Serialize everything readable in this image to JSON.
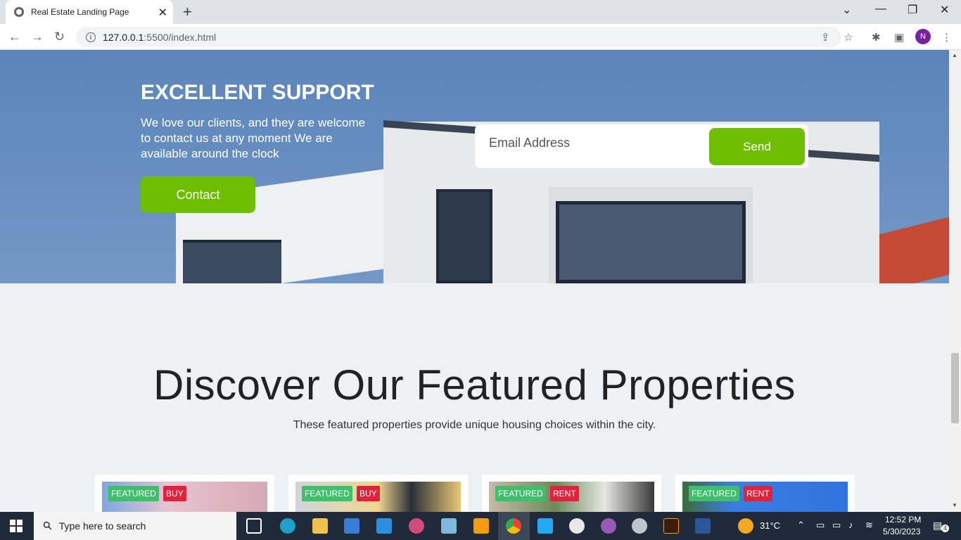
{
  "browser": {
    "tab_title": "Real Estate Landing Page",
    "url_host": "127.0.0.1",
    "url_rest": ":5500/index.html",
    "profile_initial": "N"
  },
  "hero": {
    "title": "EXCELLENT SUPPORT",
    "text": "We love our clients, and they are welcome to contact us at any moment We are available around the clock",
    "contact_label": "Contact",
    "email_placeholder": "Email Address",
    "send_label": "Send"
  },
  "featured": {
    "title": "Discover Our Featured Properties",
    "subtitle": "These featured properties provide unique housing choices within the city.",
    "cards": [
      {
        "badge1": "FEATURED",
        "badge2": "BUY"
      },
      {
        "badge1": "FEATURED",
        "badge2": "BUY"
      },
      {
        "badge1": "FEATURED",
        "badge2": "RENT"
      },
      {
        "badge1": "FEATURED",
        "badge2": "RENT"
      }
    ]
  },
  "taskbar": {
    "search_placeholder": "Type here to search",
    "weather": "31°C",
    "time": "12:52 PM",
    "date": "5/30/2023",
    "notifications": "4"
  },
  "colors": {
    "accent_green": "#6dbd00",
    "badge_featured": "#3fbf6b",
    "badge_buy": "#e0223c"
  }
}
